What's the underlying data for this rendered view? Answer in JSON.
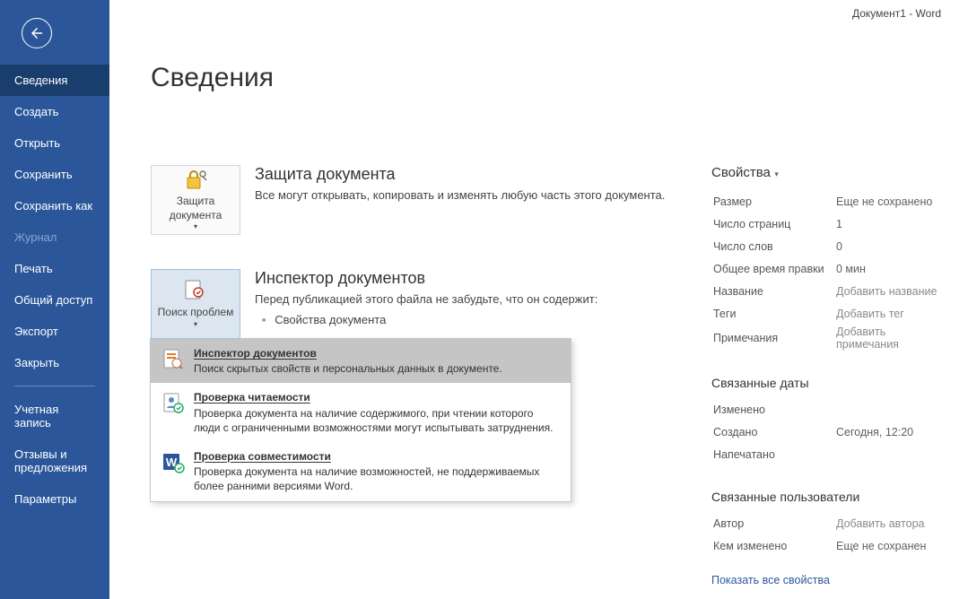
{
  "titlebar": "Документ1  -  Word",
  "nav": {
    "items": [
      {
        "label": "Сведения",
        "active": true
      },
      {
        "label": "Создать"
      },
      {
        "label": "Открыть"
      },
      {
        "label": "Сохранить"
      },
      {
        "label": "Сохранить как"
      },
      {
        "label": "Журнал",
        "disabled": true
      },
      {
        "label": "Печать"
      },
      {
        "label": "Общий доступ"
      },
      {
        "label": "Экспорт"
      },
      {
        "label": "Закрыть"
      }
    ],
    "footer": [
      "Учетная запись",
      "Отзывы и предложения",
      "Параметры"
    ]
  },
  "page": {
    "title": "Сведения"
  },
  "protect": {
    "button": "Защита документа",
    "title": "Защита документа",
    "desc": "Все могут открывать, копировать и изменять любую часть этого документа."
  },
  "inspect": {
    "button": "Поиск проблем",
    "title": "Инспектор документов",
    "desc": "Перед публикацией этого файла не забудьте, что он содержит:",
    "bullet": "Свойства документа",
    "menu": [
      {
        "title": "Инспектор документов",
        "desc": "Поиск скрытых свойств и персональных данных в документе.",
        "hl": true
      },
      {
        "title": "Проверка читаемости",
        "desc": "Проверка документа на наличие содержимого, при чтении которого люди с ограниченными возможностями могут испытывать затруднения."
      },
      {
        "title": "Проверка совместимости",
        "desc": "Проверка документа на наличие возможностей, не поддерживаемых более ранними версиями Word."
      }
    ]
  },
  "props": {
    "header": "Свойства",
    "rows": [
      {
        "k": "Размер",
        "v": "Еще не сохранено"
      },
      {
        "k": "Число страниц",
        "v": "1"
      },
      {
        "k": "Число слов",
        "v": "0"
      },
      {
        "k": "Общее время правки",
        "v": "0 мин"
      },
      {
        "k": "Название",
        "v": "Добавить название",
        "ph": true
      },
      {
        "k": "Теги",
        "v": "Добавить тег",
        "ph": true
      },
      {
        "k": "Примечания",
        "v": "Добавить примечания",
        "ph": true
      }
    ],
    "dates_header": "Связанные даты",
    "dates": [
      {
        "k": "Изменено",
        "v": ""
      },
      {
        "k": "Создано",
        "v": "Сегодня, 12:20"
      },
      {
        "k": "Напечатано",
        "v": ""
      }
    ],
    "users_header": "Связанные пользователи",
    "users": [
      {
        "k": "Автор",
        "v": "Добавить автора",
        "ph": true
      },
      {
        "k": "Кем изменено",
        "v": "Еще не сохранен"
      }
    ],
    "link": "Показать все свойства"
  }
}
